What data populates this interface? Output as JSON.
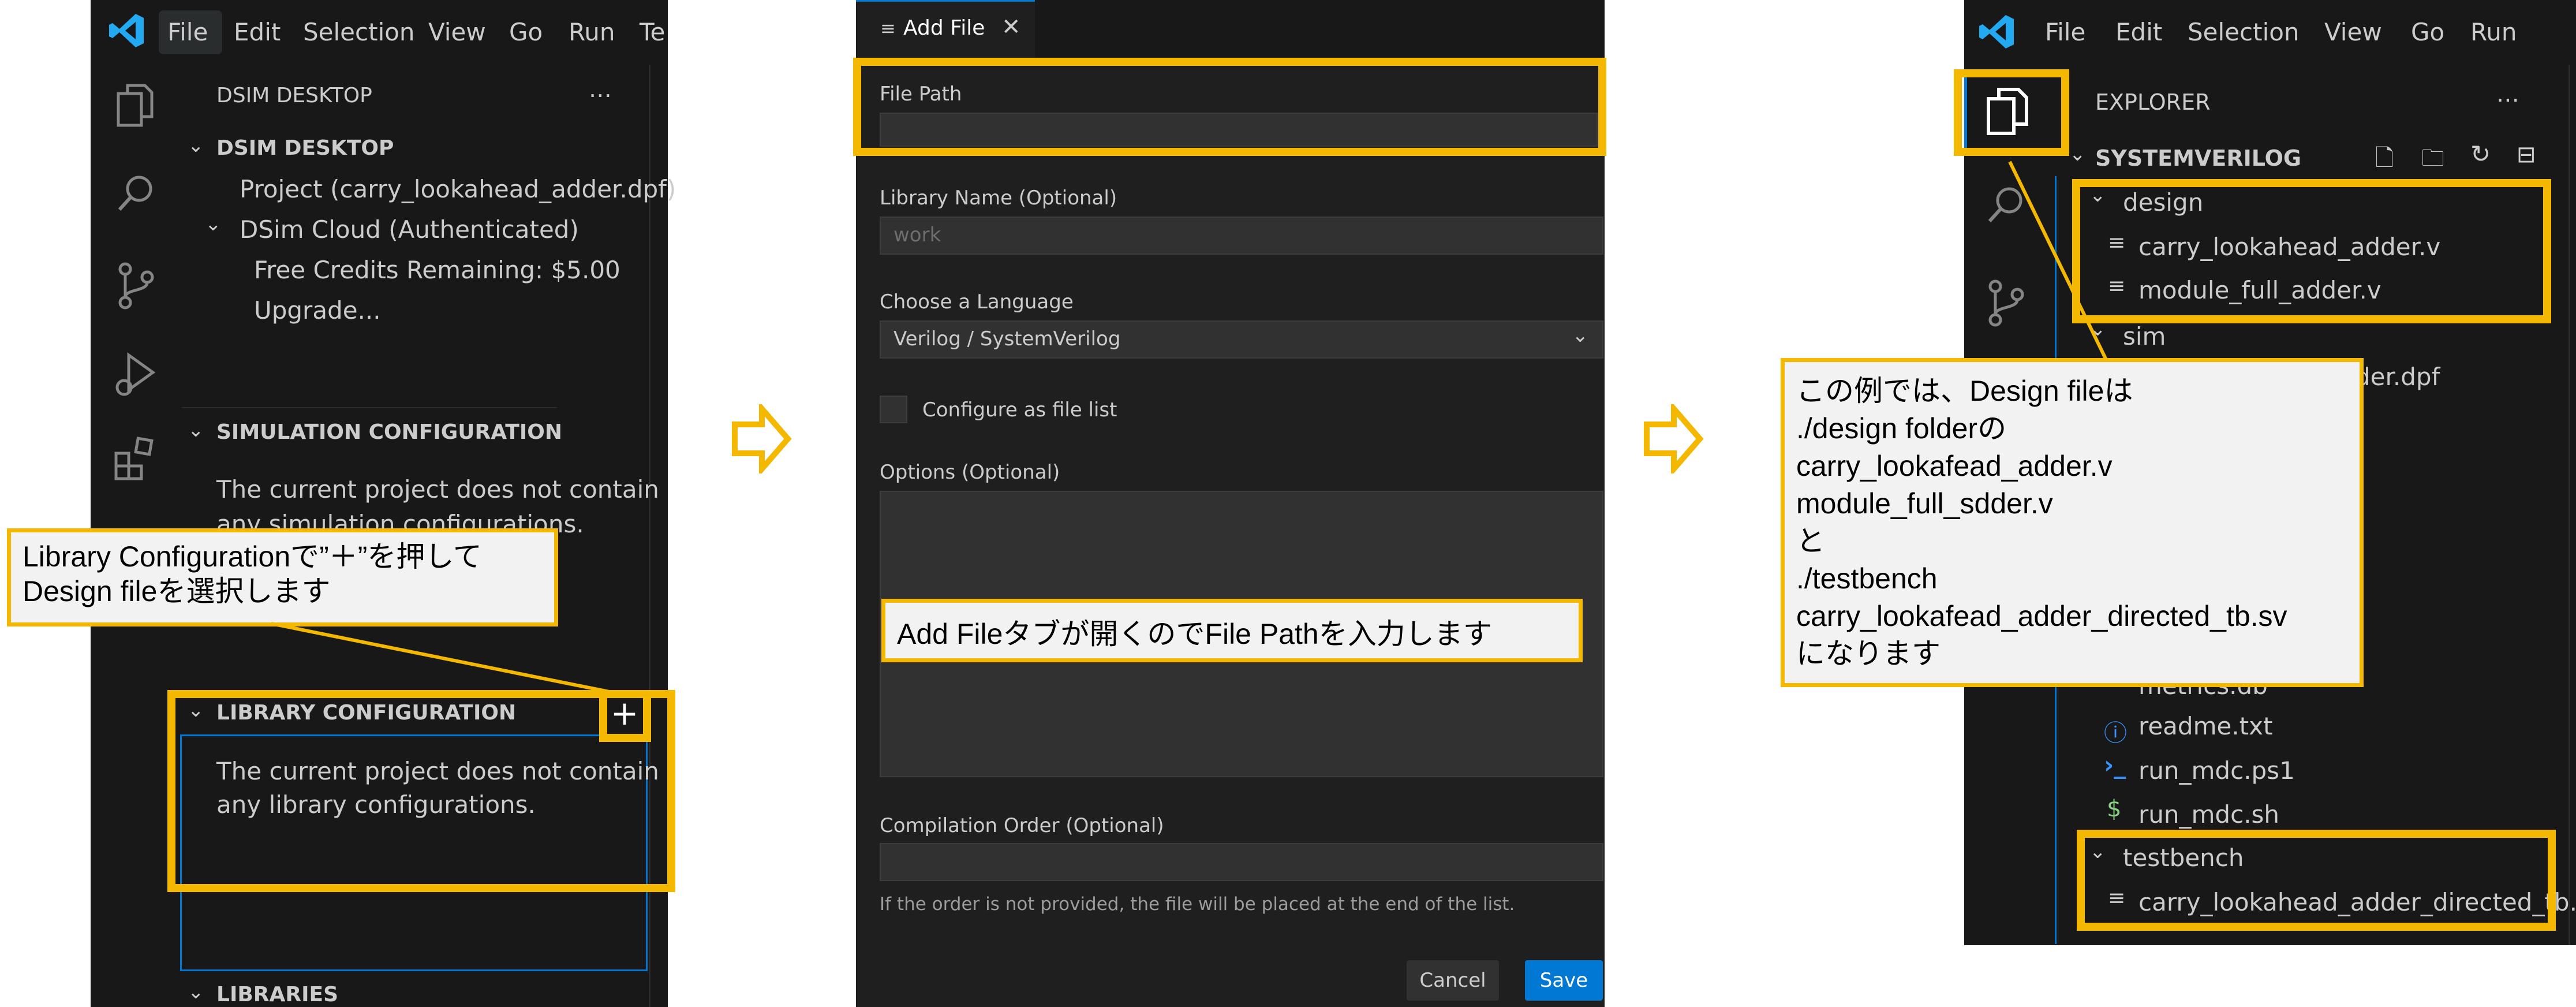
{
  "left": {
    "menu": [
      "File",
      "Edit",
      "Selection",
      "View",
      "Go",
      "Run",
      "Te"
    ],
    "sidebar_title": "DSIM DESKTOP",
    "section_dsim": "DSIM DESKTOP",
    "project_item": "Project (carry_lookahead_adder.dpf)",
    "cloud_item": "DSim Cloud (Authenticated)",
    "credits_item": "Free Credits Remaining: $5.00",
    "upgrade_item": "Upgrade...",
    "section_sim": "SIMULATION CONFIGURATION",
    "sim_text_1": "The current project does not contain",
    "sim_text_2": "any simulation configurations.",
    "section_lib": "LIBRARY CONFIGURATION",
    "lib_text_1": "The current project does not contain",
    "lib_text_2": "any library configurations.",
    "section_libraries": "LIBRARIES",
    "plus_glyph": "+",
    "callout_1": "Library Configurationで”＋”を押して",
    "callout_2": "Design fileを選択します"
  },
  "middle": {
    "tab_label": "Add File",
    "file_path_label": "File Path",
    "file_path_value": "",
    "library_label": "Library Name (Optional)",
    "library_placeholder": "work",
    "language_label": "Choose a Language",
    "language_value": "Verilog / SystemVerilog",
    "filelist_label": "Configure as file list",
    "options_label": "Options (Optional)",
    "compile_label": "Compilation Order (Optional)",
    "compile_help": "If the order is not provided, the file will be placed at the end of the list.",
    "cancel_label": "Cancel",
    "save_label": "Save",
    "callout": "Add Fileタブが開くのでFile Pathを入力します"
  },
  "right": {
    "menu": [
      "File",
      "Edit",
      "Selection",
      "View",
      "Go",
      "Run"
    ],
    "explorer_title": "EXPLORER",
    "root_folder": "SYSTEMVERILOG",
    "design_folder": "design",
    "design_file_1": "carry_lookahead_adder.v",
    "design_file_2": "module_full_adder.v",
    "sim_folder": "sim",
    "sim_file_partial": "der.dpf",
    "metrics_partial": "metrics.db",
    "readme": "readme.txt",
    "run_ps1": "run_mdc.ps1",
    "run_sh": "run_mdc.sh",
    "testbench_folder": "testbench",
    "tb_file": "carry_lookahead_adder_directed_tb...",
    "callout_lines": [
      "この例では、Design fileは",
      "./design folderの",
      "carry_lookafead_adder.v",
      "module_full_sdder.v",
      "と",
      "./testbench",
      "carry_lookafead_adder_directed_tb.sv",
      "になります"
    ]
  },
  "colors": {
    "highlight": "#f5b800",
    "accent_blue": "#0078d4",
    "editor_bg": "#181818"
  }
}
